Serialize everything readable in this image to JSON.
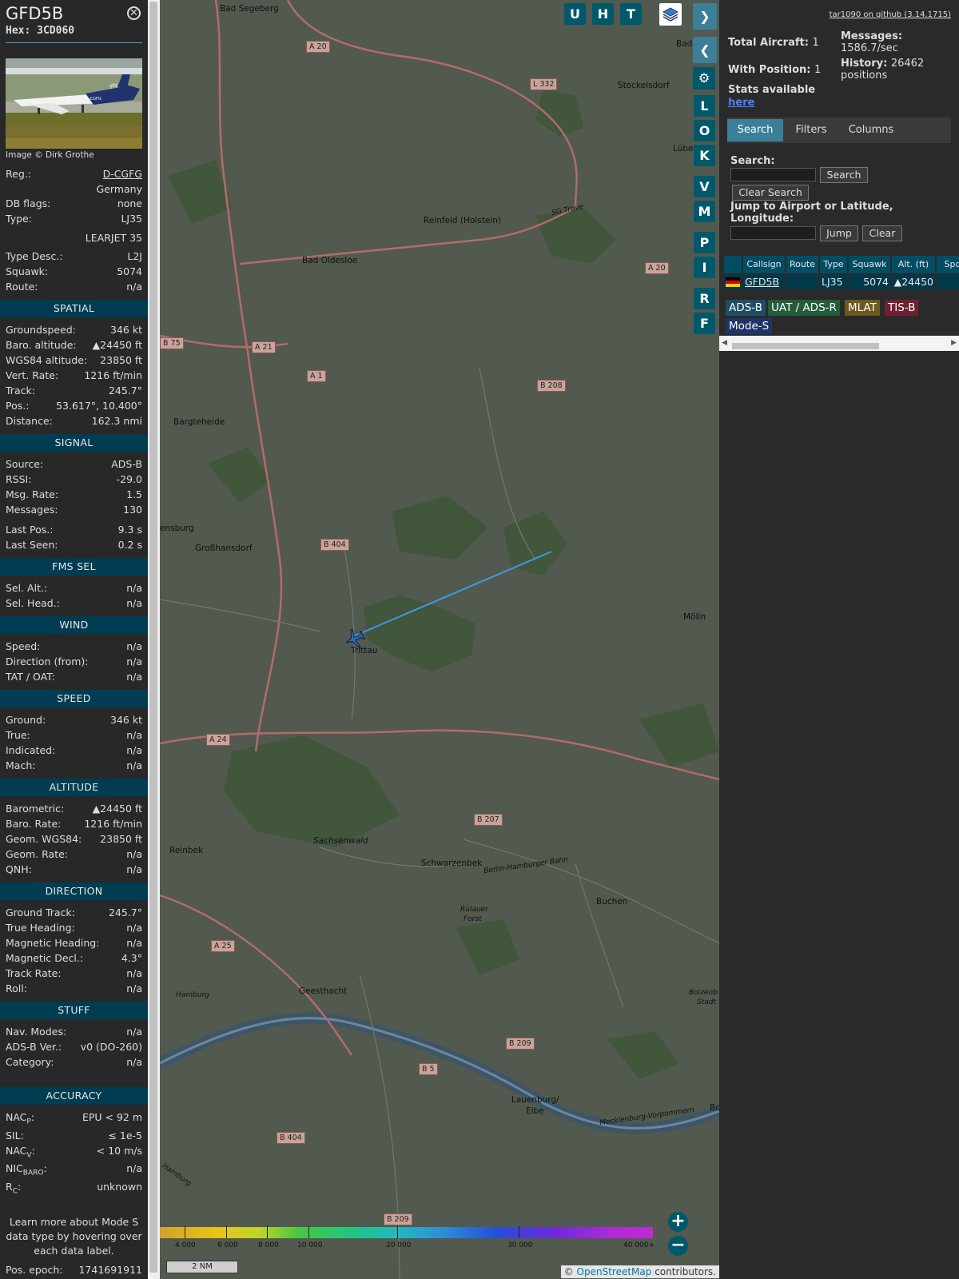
{
  "aircraft": {
    "callsign": "GFD5B",
    "hex": "Hex: 3CD060",
    "photo_credit": "Image © Dirk Grothe",
    "photo_tail": "D-CGFG",
    "photo_logo": "gfd"
  },
  "details": [
    {
      "label": "Reg.:",
      "value": "D-CGFG",
      "link": true
    },
    {
      "label": "",
      "value": "Germany"
    },
    {
      "label": "DB flags:",
      "value": "none"
    },
    {
      "label": "Type:",
      "value": "LJ35"
    },
    {
      "label": "",
      "value": "LEARJET 35"
    },
    {
      "label": "Type Desc.:",
      "value": "L2J"
    },
    {
      "label": "Squawk:",
      "value": "5074"
    },
    {
      "label": "Route:",
      "value": "n/a"
    }
  ],
  "sections": [
    {
      "title": "SPATIAL",
      "rows": [
        {
          "label": "Groundspeed:",
          "value": "346 kt"
        },
        {
          "label": "Baro. altitude:",
          "value": "▲24450 ft"
        },
        {
          "label": "WGS84 altitude:",
          "value": "23850 ft"
        },
        {
          "label": "Vert. Rate:",
          "value": "1216 ft/min"
        },
        {
          "label": "Track:",
          "value": "245.7°"
        },
        {
          "label": "Pos.:",
          "value": "53.617°, 10.400°"
        },
        {
          "label": "Distance:",
          "value": "162.3 nmi"
        }
      ]
    },
    {
      "title": "SIGNAL",
      "rows": [
        {
          "label": "Source:",
          "value": "ADS-B"
        },
        {
          "label": "RSSI:",
          "value": "-29.0"
        },
        {
          "label": "Msg. Rate:",
          "value": "1.5"
        },
        {
          "label": "Messages:",
          "value": "130"
        },
        {
          "label": "Last Pos.:",
          "value": "9.3 s"
        },
        {
          "label": "Last Seen:",
          "value": "0.2 s"
        }
      ]
    },
    {
      "title": "FMS SEL",
      "rows": [
        {
          "label": "Sel. Alt.:",
          "value": "n/a"
        },
        {
          "label": "Sel. Head.:",
          "value": "n/a"
        }
      ]
    },
    {
      "title": "WIND",
      "rows": [
        {
          "label": "Speed:",
          "value": "n/a"
        },
        {
          "label": "Direction (from):",
          "value": "n/a"
        },
        {
          "label": "TAT / OAT:",
          "value": "n/a"
        }
      ]
    },
    {
      "title": "SPEED",
      "rows": [
        {
          "label": "Ground:",
          "value": "346 kt"
        },
        {
          "label": "True:",
          "value": "n/a"
        },
        {
          "label": "Indicated:",
          "value": "n/a"
        },
        {
          "label": "Mach:",
          "value": "n/a"
        }
      ]
    },
    {
      "title": "ALTITUDE",
      "rows": [
        {
          "label": "Barometric:",
          "value": "▲24450 ft"
        },
        {
          "label": "Baro. Rate:",
          "value": "1216 ft/min"
        },
        {
          "label": "Geom. WGS84:",
          "value": "23850 ft"
        },
        {
          "label": "Geom. Rate:",
          "value": "n/a"
        },
        {
          "label": "QNH:",
          "value": "n/a"
        }
      ]
    },
    {
      "title": "DIRECTION",
      "rows": [
        {
          "label": "Ground Track:",
          "value": "245.7°"
        },
        {
          "label": "True Heading:",
          "value": "n/a"
        },
        {
          "label": "Magnetic Heading:",
          "value": "n/a"
        },
        {
          "label": "Magnetic Decl.:",
          "value": "4.3°"
        },
        {
          "label": "Track Rate:",
          "value": "n/a"
        },
        {
          "label": "Roll:",
          "value": "n/a"
        }
      ]
    },
    {
      "title": "STUFF",
      "rows": [
        {
          "label": "Nav. Modes:",
          "value": "n/a"
        },
        {
          "label": "ADS-B Ver.:",
          "value": "v0 (DO-260)"
        },
        {
          "label": "Category:",
          "value": "n/a"
        }
      ]
    },
    {
      "title": "ACCURACY",
      "rows": [
        {
          "label": "NACP:",
          "value": "EPU < 92 m"
        },
        {
          "label": "SIL:",
          "value": "≤ 1e-5"
        },
        {
          "label": "NACV:",
          "value": "< 10 m/s"
        },
        {
          "label": "NICBARO:",
          "value": "n/a"
        },
        {
          "label": "RC:",
          "value": "unknown"
        }
      ]
    }
  ],
  "accuracy_labels": {
    "nacp_main": "NAC",
    "nacp_sub": "P",
    "nacv_main": "NAC",
    "nacv_sub": "V",
    "nic_main": "NIC",
    "nic_sub": "BARO",
    "rc_main": "R",
    "rc_sub": "C"
  },
  "note": "Learn more about Mode S data type by hovering over each data label.",
  "epoch": {
    "label": "Pos. epoch:",
    "value": "1741691911"
  },
  "map": {
    "top_buttons": [
      "U",
      "H",
      "T"
    ],
    "side_buttons": [
      "L",
      "O",
      "K",
      "V",
      "M",
      "P",
      "I",
      "R",
      "F"
    ],
    "places": [
      "Bad Segeberg",
      "Stockelsdorf",
      "Lübe",
      "Bad",
      "Reinfeld (Holstein)",
      "Bad Oldesloe",
      "Bargteheide",
      "Großhansdorf",
      "ensburg",
      "Trittau",
      "Mölln",
      "Sachsenwald",
      "Reinbek",
      "Schwarzenbek",
      "Buchen",
      "Geesthacht",
      "Lauenburg/",
      "Elbe",
      "Boizenb",
      "Stadt",
      "Rülauer",
      "Forst",
      "Hamburg",
      "Berlin-Hamburger Bahn",
      "Mecklenburg-Vorpommern",
      "Bo",
      "Hamburg",
      "SG Trave"
    ],
    "roads": [
      "A 20",
      "L 332",
      "A 20",
      "B 75",
      "A 21",
      "A 1",
      "B 208",
      "B 404",
      "A 24",
      "B 207",
      "A 25",
      "B 209",
      "B 5",
      "B 404",
      "B 209"
    ],
    "colorbar_ticks": [
      "4 000",
      "6 000",
      "8 000",
      "10 000",
      "20 000",
      "30 000",
      "40 000+"
    ],
    "scale": "2 NM",
    "attribution_prefix": "© ",
    "attribution_link": "OpenStreetMap",
    "attribution_suffix": " contributors."
  },
  "right_panel": {
    "github_link": "tar1090 on github (3.14.1715)",
    "total_aircraft_label": "Total Aircraft:",
    "total_aircraft_value": "1",
    "with_position_label": "With Position:",
    "with_position_value": "1",
    "stats_label": "Stats available",
    "stats_link": "here",
    "messages_label": "Messages:",
    "messages_value": "1586.7/sec",
    "history_label": "History:",
    "history_value": "26462",
    "history_suffix": "positions",
    "tabs": [
      "Search",
      "Filters",
      "Columns"
    ],
    "search_label": "Search:",
    "search_button": "Search",
    "clear_search_button": "Clear Search",
    "jump_label": "Jump to Airport or Latitude, Longitude:",
    "jump_button": "Jump",
    "clear_button": "Clear",
    "table_headers": [
      "Callsign",
      "Route",
      "Type",
      "Squawk",
      "Alt. (ft)",
      "Spd"
    ],
    "table_rows": [
      {
        "callsign": "GFD5B",
        "route": "",
        "type": "LJ35",
        "squawk": "5074",
        "alt": "▲24450",
        "spd": ""
      }
    ],
    "badges": [
      {
        "label": "ADS-B",
        "color": "#1d4e66"
      },
      {
        "label": "UAT / ADS-R",
        "color": "#245c3c"
      },
      {
        "label": "MLAT",
        "color": "#6b5a1e"
      },
      {
        "label": "TIS-B",
        "color": "#6e2230"
      },
      {
        "label": "Mode-S",
        "color": "#1f3368"
      }
    ]
  },
  "colors": {
    "section_bg": "#003d52",
    "button_teal": "#00596b",
    "track_line": "#3c9be6"
  }
}
